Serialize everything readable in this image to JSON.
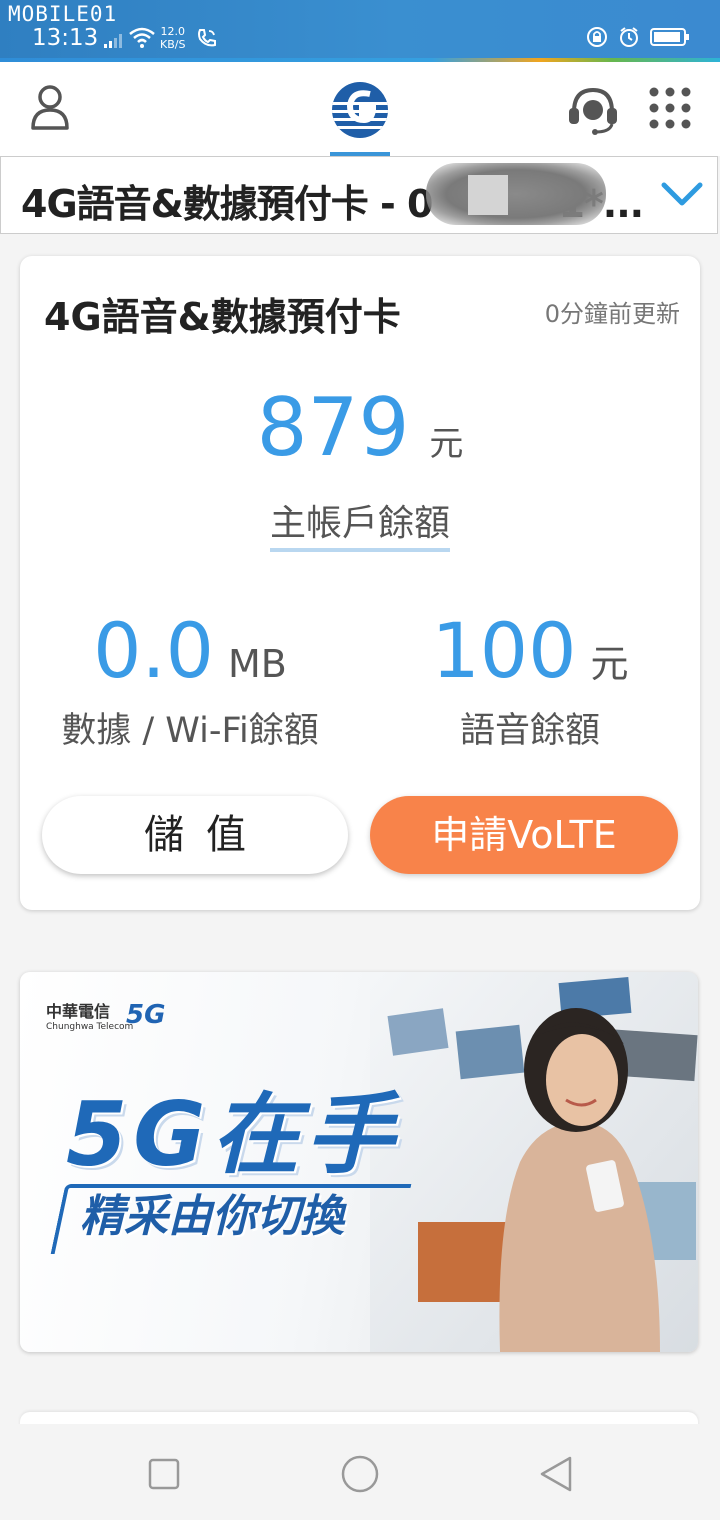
{
  "status_bar": {
    "watermark": "MOBILE01",
    "time": "13:13",
    "net_speed_value": "12.0",
    "net_speed_unit": "KB/S",
    "icons": [
      "signal-icon",
      "wifi-icon",
      "wifi-calling-icon",
      "lock-rotation-icon",
      "alarm-icon",
      "battery-icon"
    ]
  },
  "header": {
    "icons": [
      "user-icon",
      "chunghwa-logo",
      "customer-service-icon",
      "menu-grid-icon"
    ]
  },
  "account_selector": {
    "label": "4G語音&數據預付卡 - 0",
    "masked_suffix": "1*...",
    "icon": "chevron-down-icon"
  },
  "balance_card": {
    "title": "4G語音&數據預付卡",
    "updated": "0分鐘前更新",
    "main": {
      "value": "879",
      "unit": "元",
      "label": "主帳戶餘額"
    },
    "data": {
      "value": "0.0",
      "unit": "MB",
      "label": "數據 / Wi-Fi餘額"
    },
    "voice": {
      "value": "100",
      "unit": "元",
      "label": "語音餘額"
    },
    "topup_label": "儲值",
    "volte_label": "申請VoLTE"
  },
  "banner": {
    "brand_zh": "中華電信",
    "brand_en": "Chunghwa Telecom",
    "brand_5g": "5G",
    "headline": "5G在手",
    "tagline": "精采由你切換"
  },
  "nav_bar": {
    "icons": [
      "recent-apps-icon",
      "home-icon",
      "back-icon"
    ]
  },
  "colors": {
    "accent_blue": "#3a9be6",
    "volte_orange": "#f8834a",
    "status_blue": "#3a8fd0"
  }
}
